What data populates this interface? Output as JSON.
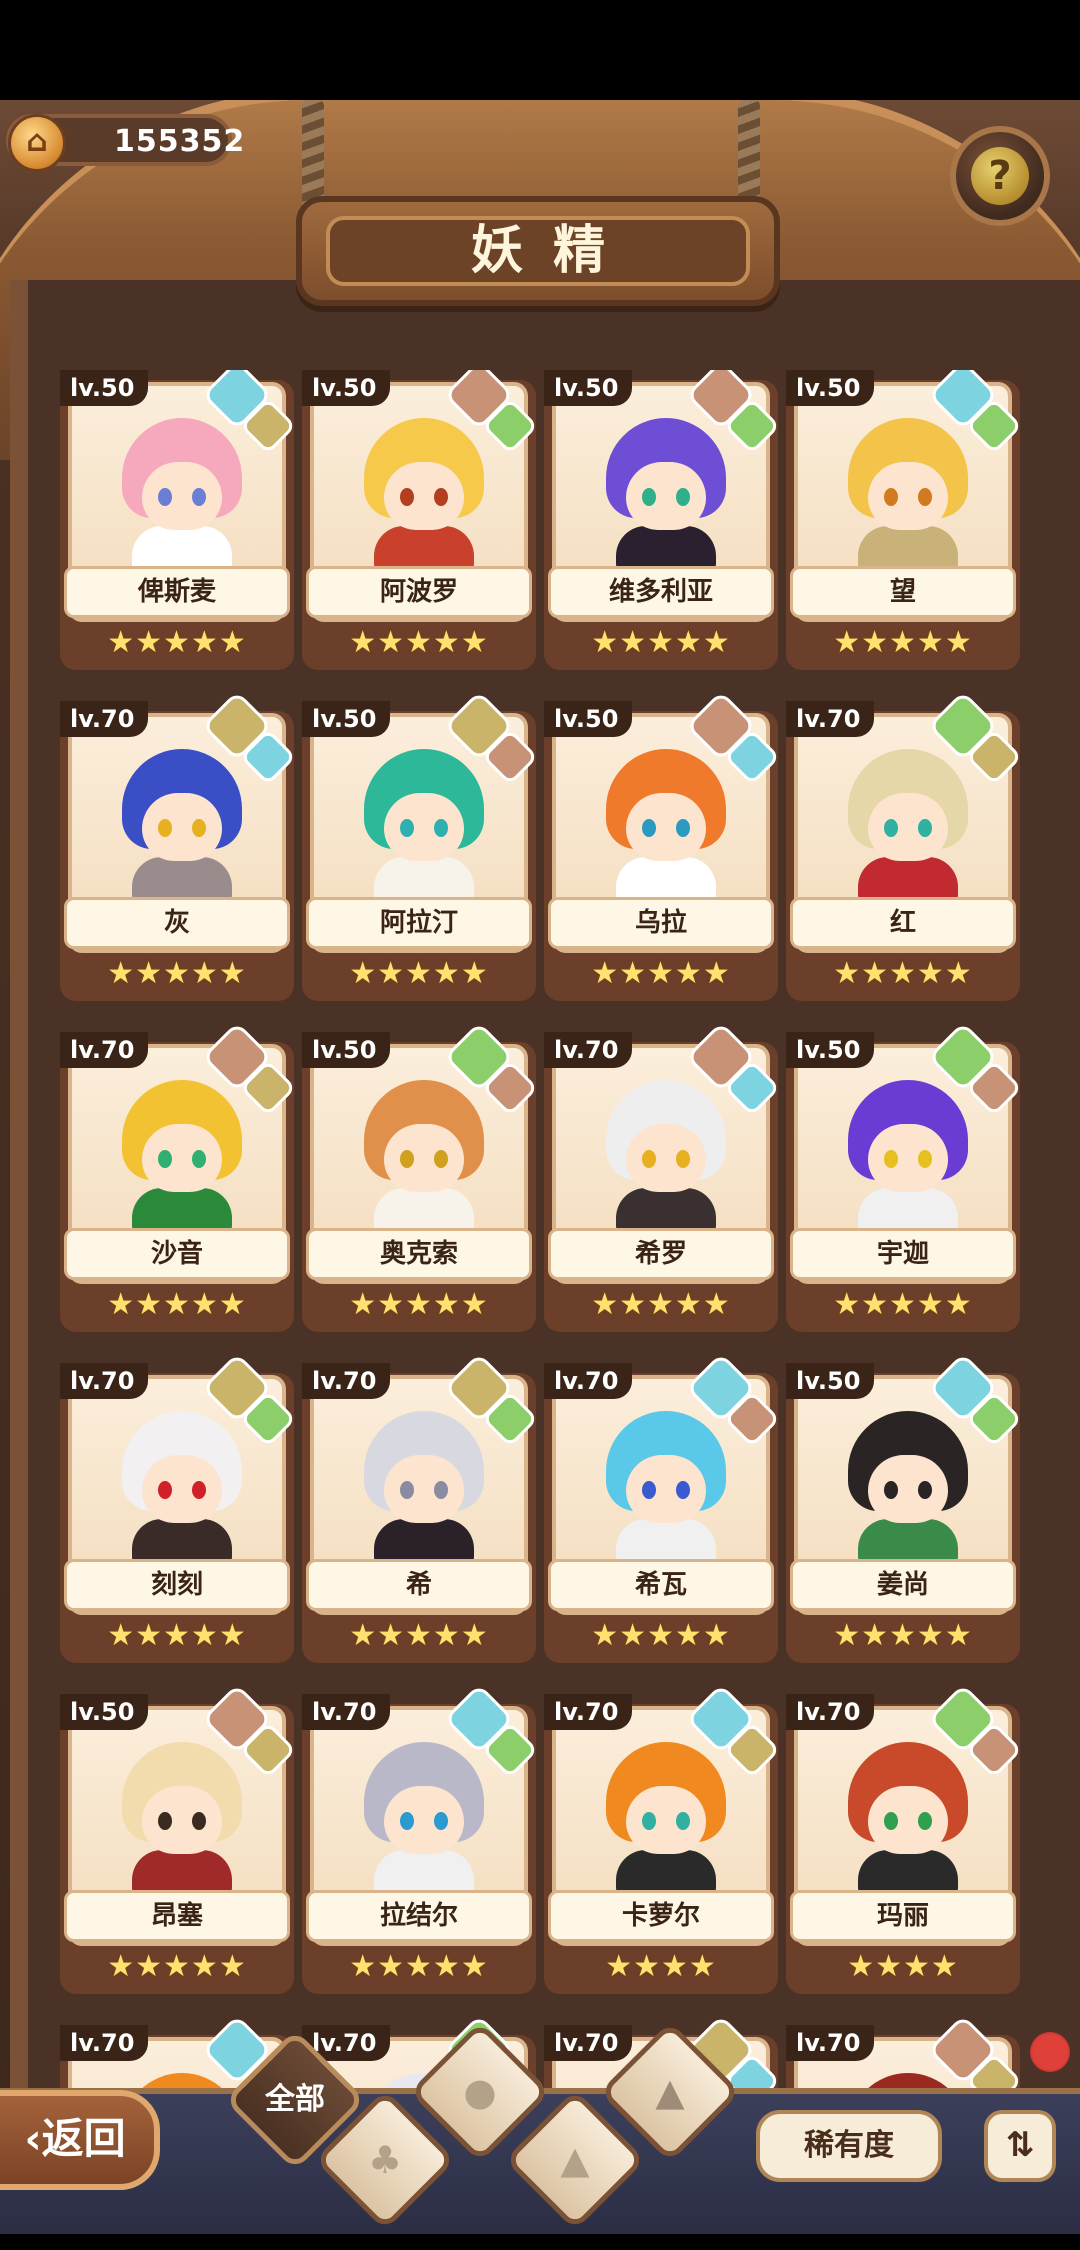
{
  "header": {
    "coins": "155352",
    "title": "妖精",
    "help_icon": "help-question-icon"
  },
  "fairies": [
    {
      "name": "俾斯麦",
      "level": "lv.50",
      "element": "water",
      "element2": "earth",
      "stars": 5,
      "hair": "#f6a8bd",
      "body": "#ffffff",
      "eye": "#6a7fd4"
    },
    {
      "name": "阿波罗",
      "level": "lv.50",
      "element": "fire",
      "element2": "wood",
      "stars": 5,
      "hair": "#f6c94a",
      "body": "#c9402c",
      "eye": "#b24020"
    },
    {
      "name": "维多利亚",
      "level": "lv.50",
      "element": "fire",
      "element2": "wood",
      "stars": 5,
      "hair": "#6f4ed6",
      "body": "#2a2030",
      "eye": "#2fb08a"
    },
    {
      "name": "望",
      "level": "lv.50",
      "element": "water",
      "element2": "wood",
      "stars": 5,
      "hair": "#f3c34a",
      "body": "#c8b27a",
      "eye": "#d27a20"
    },
    {
      "name": "灰",
      "level": "lv.70",
      "element": "earth",
      "element2": "water",
      "stars": 5,
      "hair": "#3a4fc6",
      "body": "#9a8c8c",
      "eye": "#e6b020"
    },
    {
      "name": "阿拉汀",
      "level": "lv.50",
      "element": "earth",
      "element2": "fire",
      "stars": 5,
      "hair": "#2db89a",
      "body": "#f7f2ea",
      "eye": "#2fb0b0"
    },
    {
      "name": "乌拉",
      "level": "lv.50",
      "element": "fire",
      "element2": "water",
      "stars": 5,
      "hair": "#f07a2c",
      "body": "#ffffff",
      "eye": "#2a9ac0"
    },
    {
      "name": "红",
      "level": "lv.70",
      "element": "wood",
      "element2": "earth",
      "stars": 5,
      "hair": "#e6d7a8",
      "body": "#c02a30",
      "eye": "#2fb0a0"
    },
    {
      "name": "沙音",
      "level": "lv.70",
      "element": "fire",
      "element2": "earth",
      "stars": 5,
      "hair": "#f3c232",
      "body": "#2a8a3a",
      "eye": "#2fb070"
    },
    {
      "name": "奥克索",
      "level": "lv.50",
      "element": "wood",
      "element2": "fire",
      "stars": 5,
      "hair": "#e0904a",
      "body": "#f7f2ea",
      "eye": "#d0a020"
    },
    {
      "name": "希罗",
      "level": "lv.70",
      "element": "fire",
      "element2": "water",
      "stars": 5,
      "hair": "#eeeeee",
      "body": "#3a3030",
      "eye": "#e6b020"
    },
    {
      "name": "宇迦",
      "level": "lv.50",
      "element": "wood",
      "element2": "fire",
      "stars": 5,
      "hair": "#6a3cd4",
      "body": "#f0f0f0",
      "eye": "#e6c020"
    },
    {
      "name": "刻刻",
      "level": "lv.70",
      "element": "earth",
      "element2": "wood",
      "stars": 5,
      "hair": "#f2f0f0",
      "body": "#3a2a28",
      "eye": "#d0202a"
    },
    {
      "name": "希",
      "level": "lv.70",
      "element": "earth",
      "element2": "wood",
      "stars": 5,
      "hair": "#d8d8e0",
      "body": "#2a2228",
      "eye": "#8a8aa0"
    },
    {
      "name": "希瓦",
      "level": "lv.70",
      "element": "water",
      "element2": "fire",
      "stars": 5,
      "hair": "#5ac8e8",
      "body": "#f0f0f0",
      "eye": "#3a5ad0"
    },
    {
      "name": "姜尚",
      "level": "lv.50",
      "element": "water",
      "element2": "wood",
      "stars": 5,
      "hair": "#2a2424",
      "body": "#3a8a4a",
      "eye": "#2a2424"
    },
    {
      "name": "昂塞",
      "level": "lv.50",
      "element": "fire",
      "element2": "earth",
      "stars": 5,
      "hair": "#f2dcae",
      "body": "#a02a2a",
      "eye": "#3a2a20"
    },
    {
      "name": "拉结尔",
      "level": "lv.70",
      "element": "water",
      "element2": "wood",
      "stars": 5,
      "hair": "#b8b8c8",
      "body": "#f0f0f0",
      "eye": "#2a9ad0"
    },
    {
      "name": "卡萝尔",
      "level": "lv.70",
      "element": "water",
      "element2": "earth",
      "stars": 4,
      "hair": "#f08a20",
      "body": "#2a2a2a",
      "eye": "#2fb0a0"
    },
    {
      "name": "玛丽",
      "level": "lv.70",
      "element": "wood",
      "element2": "fire",
      "stars": 4,
      "hair": "#c84a2a",
      "body": "#2a2a2a",
      "eye": "#2fa050"
    },
    {
      "name": "",
      "level": "lv.70",
      "element": "water",
      "element2": "earth",
      "stars": 0,
      "hair": "#f08a20",
      "body": "#ffffff",
      "eye": "#000000"
    },
    {
      "name": "",
      "level": "lv.70",
      "element": "wood",
      "element2": "water",
      "stars": 0,
      "hair": "#e8e8f0",
      "body": "#ffffff",
      "eye": "#000000"
    },
    {
      "name": "",
      "level": "lv.70",
      "element": "earth",
      "element2": "water",
      "stars": 0,
      "hair": "#3a2a20",
      "body": "#ffffff",
      "eye": "#000000"
    },
    {
      "name": "",
      "level": "lv.70",
      "element": "fire",
      "element2": "earth",
      "stars": 0,
      "hair": "#9a2a20",
      "body": "#ffffff",
      "eye": "#000000"
    }
  ],
  "element_colors": {
    "water": "#7ed3e0",
    "fire": "#c89276",
    "wood": "#8ccf6a",
    "earth": "#c9b46a"
  },
  "footer": {
    "back_label": "返回",
    "back_icon": "chevron-left-icon",
    "filter_all_label": "全部",
    "filter_wood_icon": "sprout-icon",
    "filter_water_icon": "droplet-icon",
    "filter_earth_icon": "hill-icon",
    "filter_fire_icon": "volcano-icon",
    "sort_label": "稀有度",
    "order_icon": "sort-order-icon"
  }
}
